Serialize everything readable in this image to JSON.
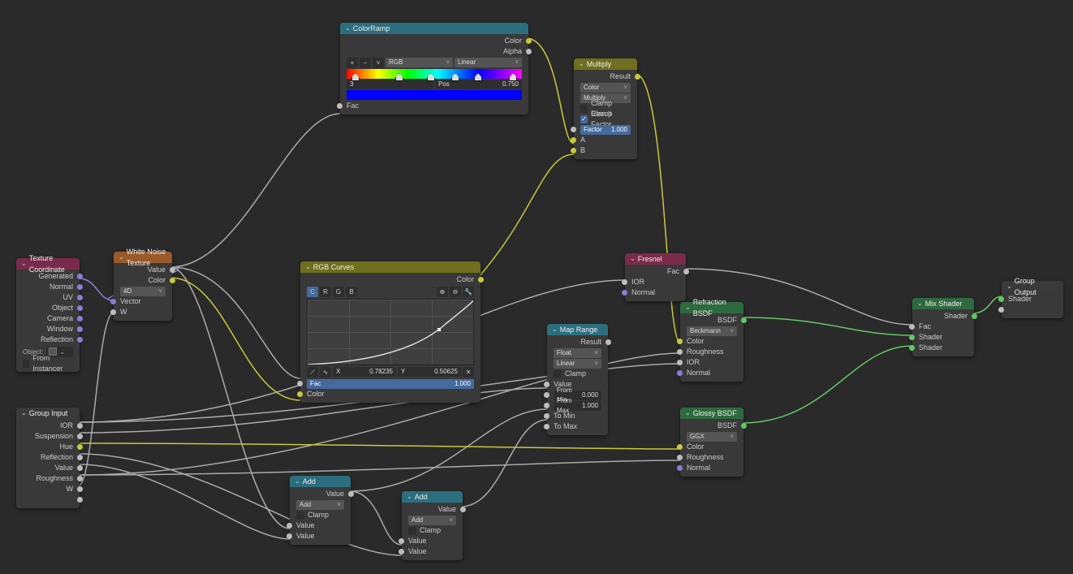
{
  "nodes": {
    "texcoord": {
      "title": "Texture Coordinate",
      "out": [
        "Generated",
        "Normal",
        "UV",
        "Object",
        "Camera",
        "Window",
        "Reflection"
      ],
      "object_label": "Object:",
      "from_instancer": "From Instancer"
    },
    "groupinput": {
      "title": "Group Input",
      "out": [
        "IOR",
        "Suspension",
        "Hue",
        "Reflection",
        "Value",
        "Roughness",
        "W"
      ]
    },
    "whitenoise": {
      "title": "White Noise Texture",
      "out": [
        "Value",
        "Color"
      ],
      "dim": "4D",
      "in": [
        "Vector",
        "W"
      ]
    },
    "colorramp": {
      "title": "ColorRamp",
      "out": [
        "Color",
        "Alpha"
      ],
      "mode1": "RGB",
      "mode2": "Linear",
      "idx": "3",
      "pos_label": "Pos",
      "pos": "0.750",
      "fac": "Fac",
      "plus": "+",
      "minus": "−",
      "menu": "˅"
    },
    "rgbcurves": {
      "title": "RGB Curves",
      "out": [
        "Color"
      ],
      "tabs": [
        "C",
        "R",
        "G",
        "B"
      ],
      "x_label": "X",
      "x": "0.78235",
      "y_label": "Y",
      "y": "0.50625",
      "fac_label": "Fac",
      "fac_val": "1.000",
      "color_in": "Color"
    },
    "multiply": {
      "title": "Multiply",
      "out": "Result",
      "color": "Color",
      "mode": "Multiply",
      "clamp_result": "Clamp Result",
      "clamp_factor": "Clamp Factor",
      "factor_label": "Factor",
      "factor": "1.000",
      "a": "A",
      "b": "B"
    },
    "fresnel": {
      "title": "Fresnel",
      "out": "Fac",
      "ior": "IOR",
      "normal": "Normal"
    },
    "maprange": {
      "title": "Map Range",
      "out": "Result",
      "type": "Float",
      "interp": "Linear",
      "clamp": "Clamp",
      "value": "Value",
      "from_min_label": "From Min",
      "from_min": "0.000",
      "from_max_label": "From Max",
      "from_max": "1.000",
      "to_min": "To Min",
      "to_max": "To Max"
    },
    "add1": {
      "title": "Add",
      "out": "Value",
      "mode": "Add",
      "clamp": "Clamp",
      "v1": "Value",
      "v2": "Value"
    },
    "add2": {
      "title": "Add",
      "out": "Value",
      "mode": "Add",
      "clamp": "Clamp",
      "v1": "Value",
      "v2": "Value"
    },
    "refraction": {
      "title": "Refraction BSDF",
      "out": "BSDF",
      "dist": "Beckmann",
      "color": "Color",
      "rough": "Roughness",
      "ior": "IOR",
      "normal": "Normal"
    },
    "glossy": {
      "title": "Glossy BSDF",
      "out": "BSDF",
      "dist": "GGX",
      "color": "Color",
      "rough": "Roughness",
      "normal": "Normal"
    },
    "mix": {
      "title": "Mix Shader",
      "out": "Shader",
      "fac": "Fac",
      "s1": "Shader",
      "s2": "Shader"
    },
    "groupoutput": {
      "title": "Group Output",
      "shader": "Shader"
    }
  }
}
